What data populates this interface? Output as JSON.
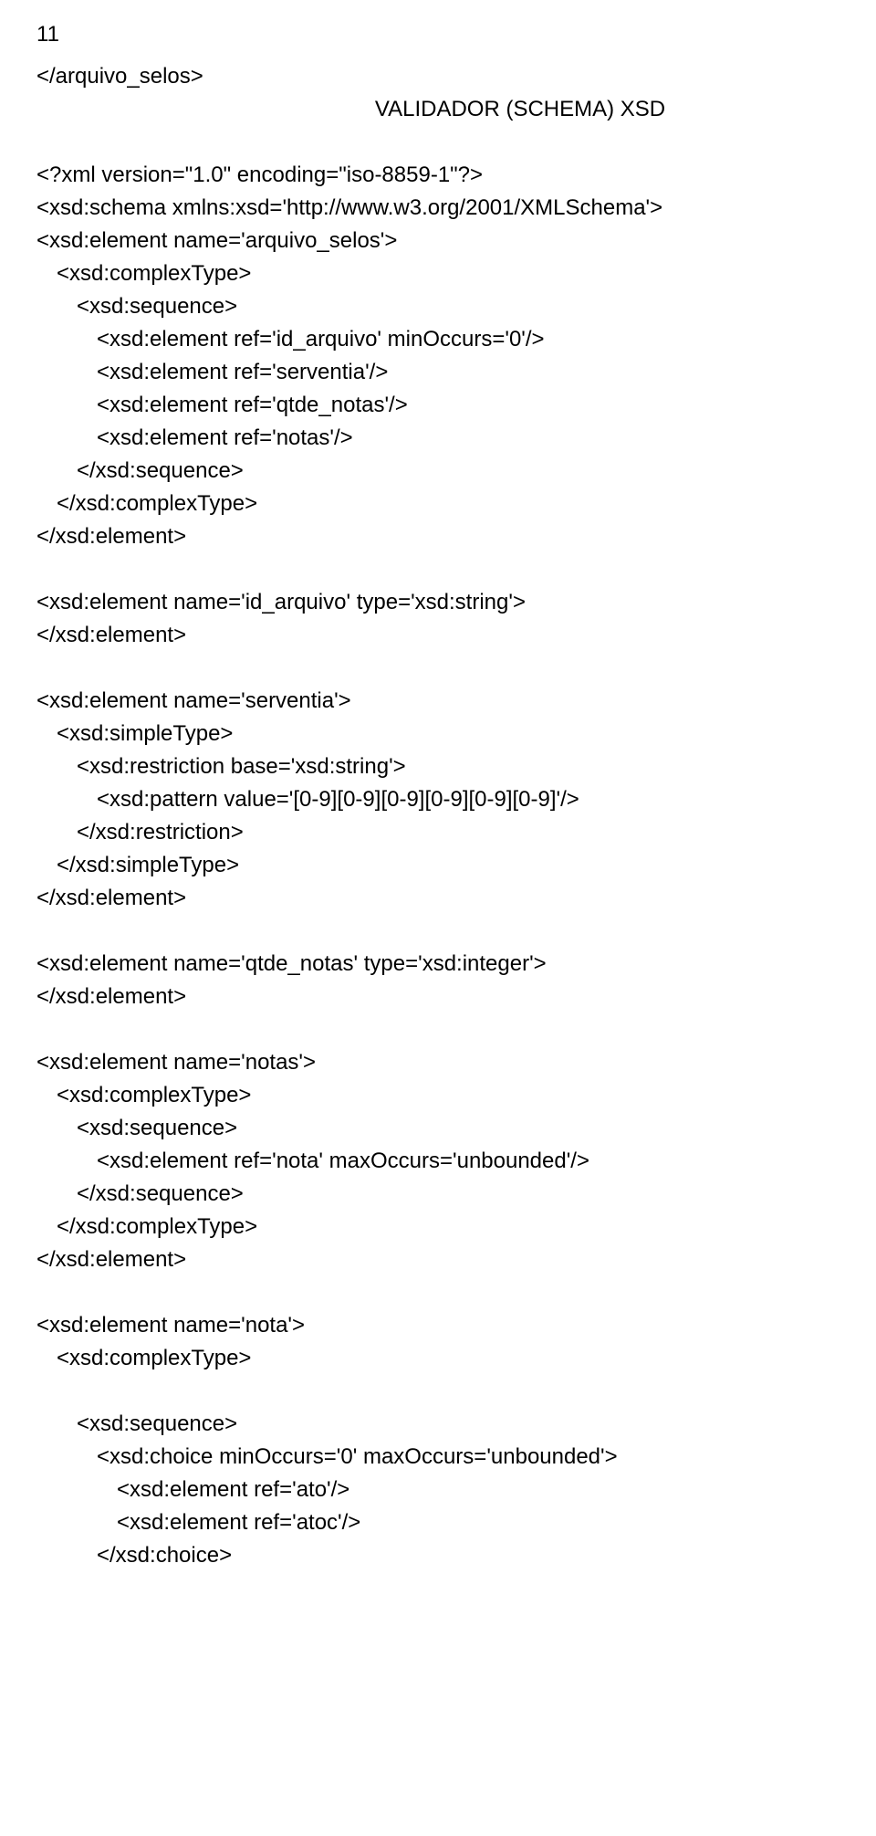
{
  "pageNumber": "11",
  "lines": [
    {
      "text": "</arquivo_selos>",
      "indent": 0
    },
    {
      "text": "VALIDADOR (SCHEMA) XSD",
      "indent": 0,
      "center": true
    },
    {
      "text": " ",
      "indent": 0
    },
    {
      "text": "<?xml version=\"1.0\" encoding=\"iso-8859-1\"?>",
      "indent": 0
    },
    {
      "text": "<xsd:schema xmlns:xsd='http://www.w3.org/2001/XMLSchema'>",
      "indent": 0
    },
    {
      "text": "<xsd:element name='arquivo_selos'>",
      "indent": 0
    },
    {
      "text": "<xsd:complexType>",
      "indent": 1
    },
    {
      "text": "<xsd:sequence>",
      "indent": 2
    },
    {
      "text": "<xsd:element ref='id_arquivo' minOccurs='0'/>",
      "indent": 3
    },
    {
      "text": "<xsd:element ref='serventia'/>",
      "indent": 3
    },
    {
      "text": "<xsd:element ref='qtde_notas'/>",
      "indent": 3
    },
    {
      "text": "<xsd:element ref='notas'/>",
      "indent": 3
    },
    {
      "text": "</xsd:sequence>",
      "indent": 2
    },
    {
      "text": "</xsd:complexType>",
      "indent": 1
    },
    {
      "text": "</xsd:element>",
      "indent": 0
    },
    {
      "text": " ",
      "indent": 0
    },
    {
      "text": "<xsd:element name='id_arquivo' type='xsd:string'>",
      "indent": 0
    },
    {
      "text": "</xsd:element>",
      "indent": 0
    },
    {
      "text": " ",
      "indent": 0
    },
    {
      "text": "<xsd:element name='serventia'>",
      "indent": 0
    },
    {
      "text": "<xsd:simpleType>",
      "indent": 1
    },
    {
      "text": "<xsd:restriction base='xsd:string'>",
      "indent": 2
    },
    {
      "text": "<xsd:pattern value='[0-9][0-9][0-9][0-9][0-9][0-9]'/>",
      "indent": 3
    },
    {
      "text": "</xsd:restriction>",
      "indent": 2
    },
    {
      "text": "</xsd:simpleType>",
      "indent": 1
    },
    {
      "text": "</xsd:element>",
      "indent": 0
    },
    {
      "text": " ",
      "indent": 0
    },
    {
      "text": "<xsd:element name='qtde_notas' type='xsd:integer'>",
      "indent": 0
    },
    {
      "text": "</xsd:element>",
      "indent": 0
    },
    {
      "text": " ",
      "indent": 0
    },
    {
      "text": "<xsd:element name='notas'>",
      "indent": 0
    },
    {
      "text": "<xsd:complexType>",
      "indent": 1
    },
    {
      "text": "<xsd:sequence>",
      "indent": 2
    },
    {
      "text": "<xsd:element ref='nota' maxOccurs='unbounded'/>",
      "indent": 3
    },
    {
      "text": "</xsd:sequence>",
      "indent": 2
    },
    {
      "text": "</xsd:complexType>",
      "indent": 1
    },
    {
      "text": "</xsd:element>",
      "indent": 0
    },
    {
      "text": " ",
      "indent": 0
    },
    {
      "text": "<xsd:element name='nota'>",
      "indent": 0
    },
    {
      "text": "<xsd:complexType>",
      "indent": 1
    },
    {
      "text": " ",
      "indent": 0
    },
    {
      "text": "<xsd:sequence>",
      "indent": 2
    },
    {
      "text": "<xsd:choice minOccurs='0' maxOccurs='unbounded'>",
      "indent": 3
    },
    {
      "text": "<xsd:element ref='ato'/>",
      "indent": 4
    },
    {
      "text": "<xsd:element ref='atoc'/>",
      "indent": 4
    },
    {
      "text": "</xsd:choice>",
      "indent": 3
    }
  ]
}
